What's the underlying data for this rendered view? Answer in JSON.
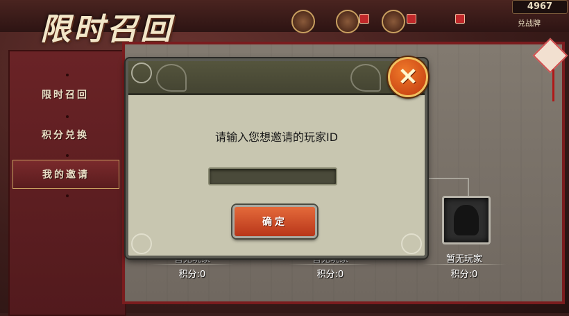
{
  "header": {
    "title": "限时召回",
    "currency_value": "4967",
    "exchange_label": "兑战牌"
  },
  "sidebar": {
    "items": [
      {
        "label": "限时召回",
        "active": false
      },
      {
        "label": "积分兑换",
        "active": false
      },
      {
        "label": "我的邀请",
        "active": true
      }
    ]
  },
  "players": [
    {
      "name": "暂无玩家",
      "score": "积分:0"
    },
    {
      "name": "暂无玩家",
      "score": "积分:0"
    },
    {
      "name": "暂无玩家",
      "score": "积分:0"
    }
  ],
  "dialog": {
    "prompt": "请输入您想邀请的玩家ID",
    "input_value": "",
    "confirm_label": "确定",
    "close_icon": "close-icon"
  },
  "colors": {
    "sidebar_bg": "#6a2326",
    "dialog_bg": "#c8c6b0",
    "confirm_button": "#d4502a",
    "close_button": "#e0581c"
  }
}
